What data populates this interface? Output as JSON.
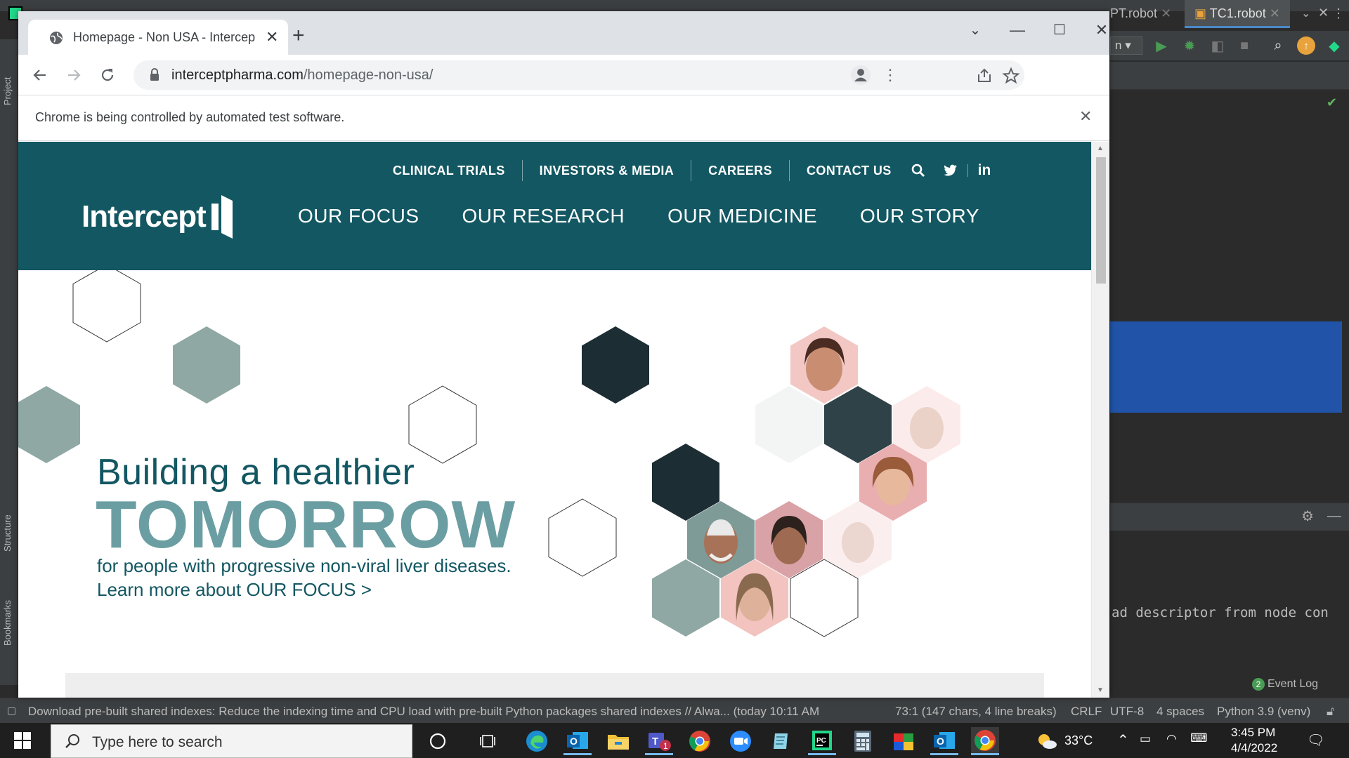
{
  "ide": {
    "run_config": "n",
    "tabs": [
      "PT.robot",
      "TC1.robot"
    ],
    "console_text": "ad descriptor from node con",
    "left_labels": [
      "Project",
      "Structure",
      "Bookmarks"
    ],
    "status_message": "Download pre-built shared indexes: Reduce the indexing time and CPU load with pre-built Python packages shared indexes // Alwa... (today 10:11 AM",
    "status_position": "73:1 (147 chars, 4 line breaks)",
    "status_line_sep": "CRLF",
    "status_encoding": "UTF-8",
    "status_indent": "4 spaces",
    "status_interpreter": "Python 3.9 (venv)",
    "event_log_count": "2",
    "event_log_label": "Event Log"
  },
  "browser": {
    "tab_title": "Homepage - Non USA - Intercep",
    "url_domain": "interceptpharma.com",
    "url_path": "/homepage-non-usa/",
    "infobar_text": "Chrome is being controlled by automated test software."
  },
  "site": {
    "util_nav": [
      "CLINICAL TRIALS",
      "INVESTORS & MEDIA",
      "CAREERS",
      "CONTACT US"
    ],
    "logo_text": "Intercept",
    "main_nav": [
      "OUR FOCUS",
      "OUR RESEARCH",
      "OUR MEDICINE",
      "OUR STORY"
    ],
    "hero": {
      "line1": "Building a healthier",
      "line2": "TOMORROW",
      "line3": "for people with progressive non-viral liver diseases.",
      "line4": "Learn more about OUR FOCUS >"
    },
    "colors": {
      "header": "#135762",
      "accent": "#6b9ea2",
      "dark_hex": "#1c2d33",
      "sage_hex": "#8fa8a4"
    }
  },
  "taskbar": {
    "search_placeholder": "Type here to search",
    "weather": "33°C",
    "time": "3:45 PM",
    "date": "4/4/2022",
    "apps": [
      "cortana-icon",
      "task-view-icon",
      "edge-icon",
      "outlook-icon",
      "file-explorer-icon",
      "teams-icon",
      "chrome-icon",
      "zoom-icon",
      "notepad-icon",
      "pycharm-icon",
      "calculator-icon",
      "paint-icon",
      "outlook-icon",
      "chrome-icon"
    ],
    "teams_badge": "1"
  }
}
